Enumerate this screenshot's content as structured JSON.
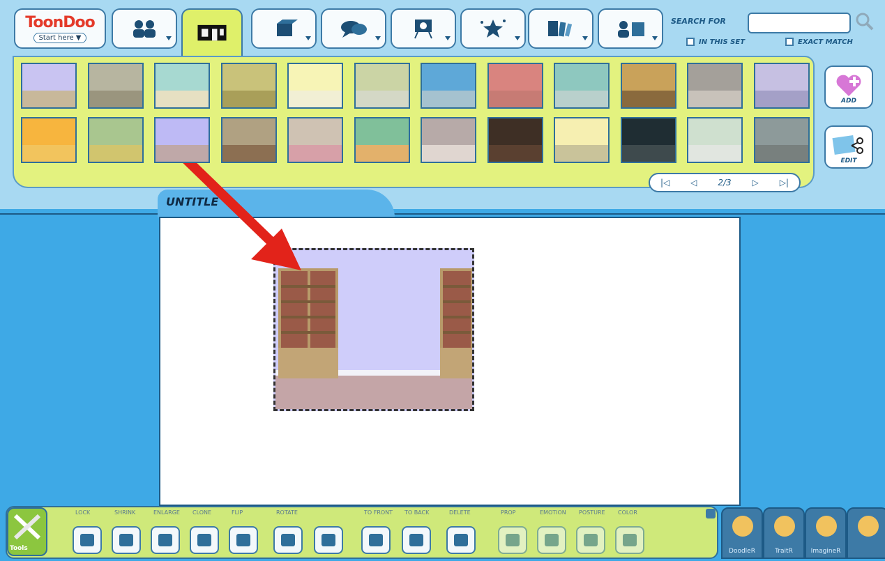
{
  "app": {
    "logo_text": "ToonDoo",
    "start_label": "Start here ▼"
  },
  "top_tabs": [
    {
      "name": "characters",
      "icon": "characters-icon"
    },
    {
      "name": "backgrounds",
      "icon": "backgrounds-icon",
      "active": true
    },
    {
      "name": "props",
      "icon": "props-icon"
    },
    {
      "name": "speech-bubbles",
      "icon": "speech-bubble-icon"
    },
    {
      "name": "text",
      "icon": "easel-icon"
    },
    {
      "name": "special-effects",
      "icon": "stars-icon"
    },
    {
      "name": "scenes",
      "icon": "panels-icon"
    },
    {
      "name": "my-stuff",
      "icon": "user-frame-icon"
    }
  ],
  "search": {
    "label": "SEARCH FOR",
    "value": "",
    "in_this_set": "IN THIS SET",
    "exact_match": "EXACT MATCH"
  },
  "palette": {
    "pager": "2/3",
    "add_label": "ADD",
    "edit_label": "EDIT",
    "thumb_colors": [
      [
        "#c9c4f2",
        "#c8b89a"
      ],
      [
        "#b7b5a0",
        "#9a957e"
      ],
      [
        "#a7d9d1",
        "#e6e0c2"
      ],
      [
        "#c9c27a",
        "#a99f59"
      ],
      [
        "#f7f4b6",
        "#f1efd4"
      ],
      [
        "#cbd4a5",
        "#d4d8c6"
      ],
      [
        "#5ea8d8",
        "#a5c2cf"
      ],
      [
        "#d9847f",
        "#c77b74"
      ],
      [
        "#8ec8bf",
        "#b9d0cc"
      ],
      [
        "#c9a25a",
        "#8a6a3d"
      ],
      [
        "#a4a09a",
        "#c8c2ba"
      ],
      [
        "#c6c0e2",
        "#a4a0c7"
      ],
      [
        "#f7b53e",
        "#f2c45d"
      ],
      [
        "#a9c68f",
        "#d1c56e"
      ],
      [
        "#bebaf5",
        "#bfa8a8"
      ],
      [
        "#b0a182",
        "#8c6f52"
      ],
      [
        "#cfc2b3",
        "#d7a0a8"
      ],
      [
        "#80c09a",
        "#e3b16b"
      ],
      [
        "#b7aaa8",
        "#e0d6d0"
      ],
      [
        "#3e2f25",
        "#5a4030"
      ],
      [
        "#f6efb1",
        "#c9c39a"
      ],
      [
        "#1f2d33",
        "#3e4a4d"
      ],
      [
        "#cfe0cf",
        "#e1e6e0"
      ],
      [
        "#8d9a9a",
        "#78807e"
      ]
    ]
  },
  "document": {
    "title": "UNTITLE"
  },
  "toolbar": {
    "tools_label": "Tools",
    "buttons": [
      {
        "label": "LOCK",
        "icon": "lock-icon"
      },
      {
        "label": "SHRINK",
        "icon": "shrink-icon"
      },
      {
        "label": "ENLARGE",
        "icon": "enlarge-icon"
      },
      {
        "label": "CLONE",
        "icon": "clone-icon"
      },
      {
        "label": "FLIP",
        "icon": "flip-icon"
      },
      {
        "label": "ROTATE",
        "icon": "rotate-left-icon"
      },
      {
        "label": "",
        "icon": "rotate-right-icon"
      },
      {
        "label": "TO FRONT",
        "icon": "to-front-icon"
      },
      {
        "label": "TO BACK",
        "icon": "to-back-icon"
      },
      {
        "label": "DELETE",
        "icon": "delete-icon"
      },
      {
        "label": "PROP",
        "icon": "prop-icon"
      },
      {
        "label": "EMOTION",
        "icon": "emotion-icon"
      },
      {
        "label": "POSTURE",
        "icon": "posture-icon"
      },
      {
        "label": "COLOR",
        "icon": "color-icon"
      }
    ]
  },
  "plugins": [
    {
      "label": "DoodleR",
      "icon": "palette-icon"
    },
    {
      "label": "TraitR",
      "icon": "face-icon"
    },
    {
      "label": "ImagineR",
      "icon": "camera-icon"
    },
    {
      "label": "",
      "icon": "help-box-icon"
    }
  ],
  "colors": {
    "primary_blue": "#3ea9e6",
    "palette_green": "#e3f27f",
    "arrow_red": "#e2231a"
  }
}
